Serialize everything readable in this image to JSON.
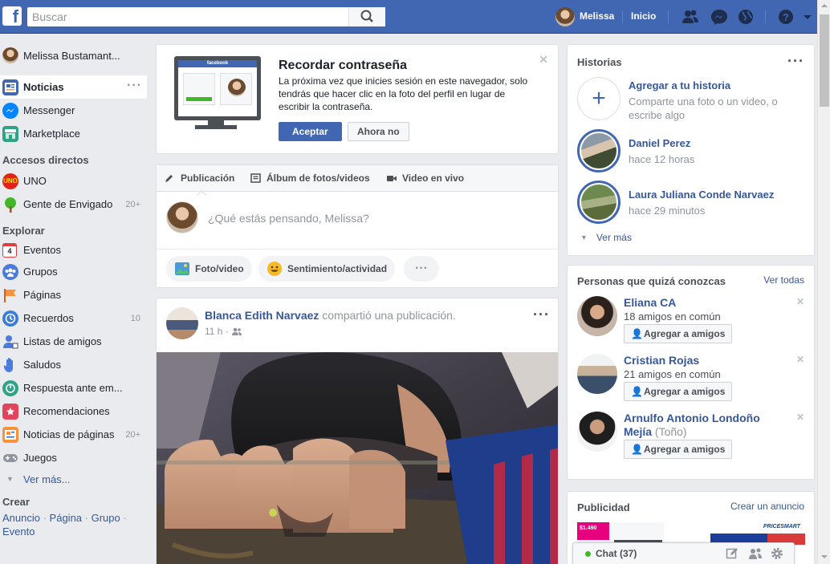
{
  "header": {
    "search_placeholder": "Buscar",
    "user_name": "Melissa",
    "home": "Inicio"
  },
  "sidebar": {
    "profile_name": "Melissa Bustamant...",
    "main": [
      {
        "label": "Noticias",
        "icon": "news-feed-icon"
      },
      {
        "label": "Messenger",
        "icon": "messenger-icon"
      },
      {
        "label": "Marketplace",
        "icon": "marketplace-icon"
      }
    ],
    "shortcuts_title": "Accesos directos",
    "shortcuts": [
      {
        "label": "UNO",
        "icon": "uno-game-icon",
        "count": ""
      },
      {
        "label": "Gente de Envigado",
        "icon": "tree-group-icon",
        "count": "20+"
      }
    ],
    "explore_title": "Explorar",
    "explore": [
      {
        "label": "Eventos",
        "icon": "calendar-icon",
        "count": ""
      },
      {
        "label": "Grupos",
        "icon": "groups-icon",
        "count": ""
      },
      {
        "label": "Páginas",
        "icon": "flag-icon",
        "count": ""
      },
      {
        "label": "Recuerdos",
        "icon": "memories-clock-icon",
        "count": "10"
      },
      {
        "label": "Listas de amigos",
        "icon": "friend-lists-icon",
        "count": ""
      },
      {
        "label": "Saludos",
        "icon": "wave-hand-icon",
        "count": ""
      },
      {
        "label": "Respuesta ante em...",
        "icon": "crisis-response-icon",
        "count": ""
      },
      {
        "label": "Recomendaciones",
        "icon": "recommendations-icon",
        "count": ""
      },
      {
        "label": "Noticias de páginas",
        "icon": "pages-feed-icon",
        "count": "20+"
      },
      {
        "label": "Juegos",
        "icon": "gamepad-icon",
        "count": ""
      }
    ],
    "see_more": "Ver más...",
    "calendar_day": "4",
    "create_title": "Crear",
    "create_links": [
      "Anuncio",
      "Página",
      "Grupo",
      "Evento"
    ]
  },
  "password_reminder": {
    "title": "Recordar contraseña",
    "text": "La próxima vez que inicies sesión en este navegador, solo tendrás que hacer clic en la foto del perfil en lugar de escribir la contraseña.",
    "accept": "Aceptar",
    "decline": "Ahora no",
    "illustration_brand": "facebook"
  },
  "composer": {
    "tabs": [
      "Publicación",
      "Álbum de fotos/videos",
      "Video en vivo"
    ],
    "placeholder": "¿Qué estás pensando, Melissa?",
    "actions": [
      "Foto/video",
      "Sentimiento/actividad"
    ]
  },
  "post": {
    "author": "Blanca Edith Narvaez",
    "action": "compartió una publicación.",
    "time": "11 h ·"
  },
  "stories": {
    "title": "Historias",
    "add_title": "Agregar a tu historia",
    "add_subtitle": "Comparte una foto o un video, o escribe algo",
    "items": [
      {
        "name": "Daniel Perez",
        "time": "hace 12 horas"
      },
      {
        "name": "Laura Juliana Conde Narvaez",
        "time": "hace 29 minutos"
      }
    ],
    "see_more": "Ver más"
  },
  "pymk": {
    "title": "Personas que quizá conozcas",
    "see_all": "Ver todas",
    "people": [
      {
        "name": "Eliana CA",
        "detail": "18 amigos en común",
        "button": "Agregar a amigos"
      },
      {
        "name": "Cristian Rojas",
        "detail": "21 amigos en común",
        "button": "Agregar a amigos"
      },
      {
        "name": "Arnulfo Antonio Londoño Mejía",
        "detail": "(Toño)",
        "button": "Agregar a amigos"
      }
    ]
  },
  "ads": {
    "title": "Publicidad",
    "create": "Crear un anuncio",
    "price_tag": "$1.490",
    "brand": "PRICESMART"
  },
  "chat": {
    "label": "Chat (37)"
  }
}
